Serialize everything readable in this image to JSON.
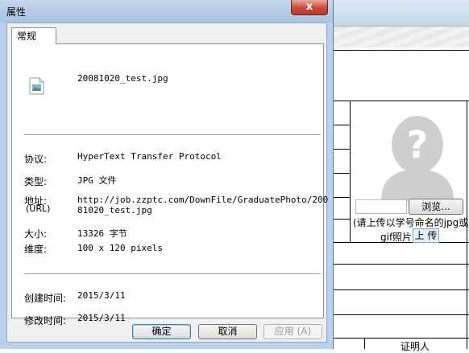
{
  "dialog": {
    "title": "属性",
    "close_glyph": "x",
    "tab": "常规",
    "file_name": "20081020_test.jpg",
    "fields": {
      "protocol_label": "协议:",
      "protocol_value": "HyperText Transfer Protocol",
      "type_label": "类型:",
      "type_value": "JPG 文件",
      "address_label": "地址:",
      "address_sub_label": "(URL)",
      "address_line1": "http://job.zzptc.com/DownFile/GraduatePhoto/200",
      "address_line2": "81020_test.jpg",
      "size_label": "大小:",
      "size_value": "13326 字节",
      "dimensions_label": "维度:",
      "dimensions_value": "100  x  120  pixels",
      "created_label": "创建时间:",
      "created_value": "2015/3/11",
      "modified_label": "修改时间:",
      "modified_value": "2015/3/11"
    },
    "buttons": {
      "ok": "确定",
      "cancel": "取消",
      "apply": "应用 (A)"
    }
  },
  "background_form": {
    "browse_button": "浏览...",
    "hint_line1": "(请上传以学号命名的jpg或",
    "hint_line2": "gif照片)",
    "upload_button": "上 传",
    "witness_label": "证明人"
  },
  "colors": {
    "dialog_frame": "#b9d1ea",
    "client_bg": "#f0f0f0",
    "close_button": "#c74a3a"
  }
}
